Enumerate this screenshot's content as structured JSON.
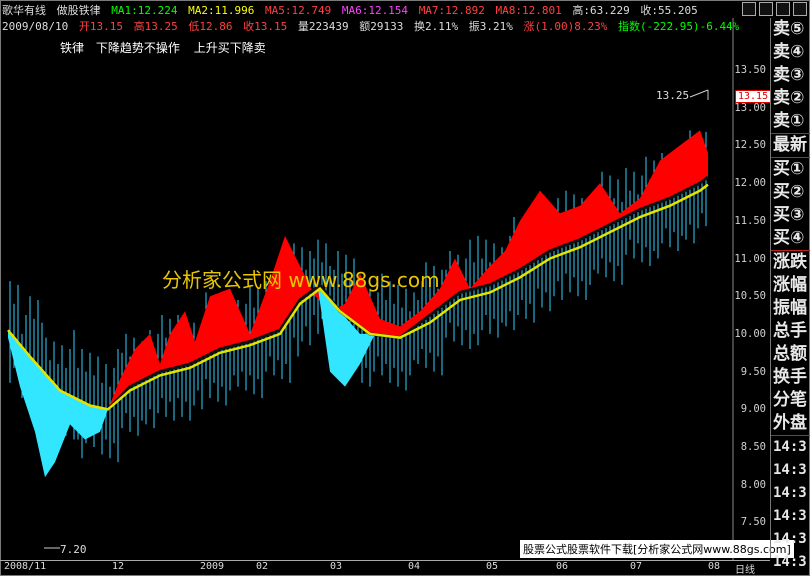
{
  "header1": {
    "indicator": "歌华有线",
    "name": "做股铁律",
    "ma1": "MA1:12.224",
    "ma2": "MA2:11.996",
    "ma5": "MA5:12.749",
    "ma6": "MA6:12.154",
    "ma7": "MA7:12.892",
    "ma8": "MA8:12.801",
    "high": "高:63.229",
    "close": "收:55.205"
  },
  "header2": {
    "date": "2009/08/10",
    "open": "开13.15",
    "high": "高13.25",
    "low": "低12.86",
    "close": "收13.15",
    "volume": "量223439",
    "amount": "额29133",
    "turnover": "换2.11%",
    "amplitude": "振3.21%",
    "change": "涨(1.00)8.23%",
    "index": "指数(-222.95)-6.44%"
  },
  "indicator_desc": {
    "name": "铁律",
    "rule1": "下降趋势不操作",
    "rule2": "上升买下降卖"
  },
  "y_axis": [
    "13.50",
    "13.00",
    "12.50",
    "12.00",
    "11.50",
    "11.00",
    "10.50",
    "10.00",
    "9.50",
    "9.00",
    "8.50",
    "8.00",
    "7.50"
  ],
  "x_axis": [
    "2008/11",
    "12",
    "2009",
    "02",
    "03",
    "04",
    "05",
    "06",
    "07",
    "08",
    "日线"
  ],
  "annotations": {
    "high": "13.25",
    "low": "7.20",
    "last": "13.15"
  },
  "watermark": "分析家公式网 www.88gs.com",
  "banner": "股票公式股票软件下载[分析家公式网www.88gs.com]",
  "right_panel": [
    "卖⑤",
    "卖④",
    "卖③",
    "卖②",
    "卖①",
    "最新",
    "买①",
    "买②",
    "买③",
    "买④",
    "涨跌",
    "涨幅",
    "振幅",
    "总手",
    "总额",
    "换手",
    "分笔",
    "外盘",
    "14:3",
    "14:3",
    "14:3",
    "14:3",
    "14:3",
    "14:3"
  ],
  "colors": {
    "up": "#ff0000",
    "down": "#00ffff",
    "ma_long": "#e0e000",
    "ma_short": "#000000",
    "bg": "#000000"
  }
}
